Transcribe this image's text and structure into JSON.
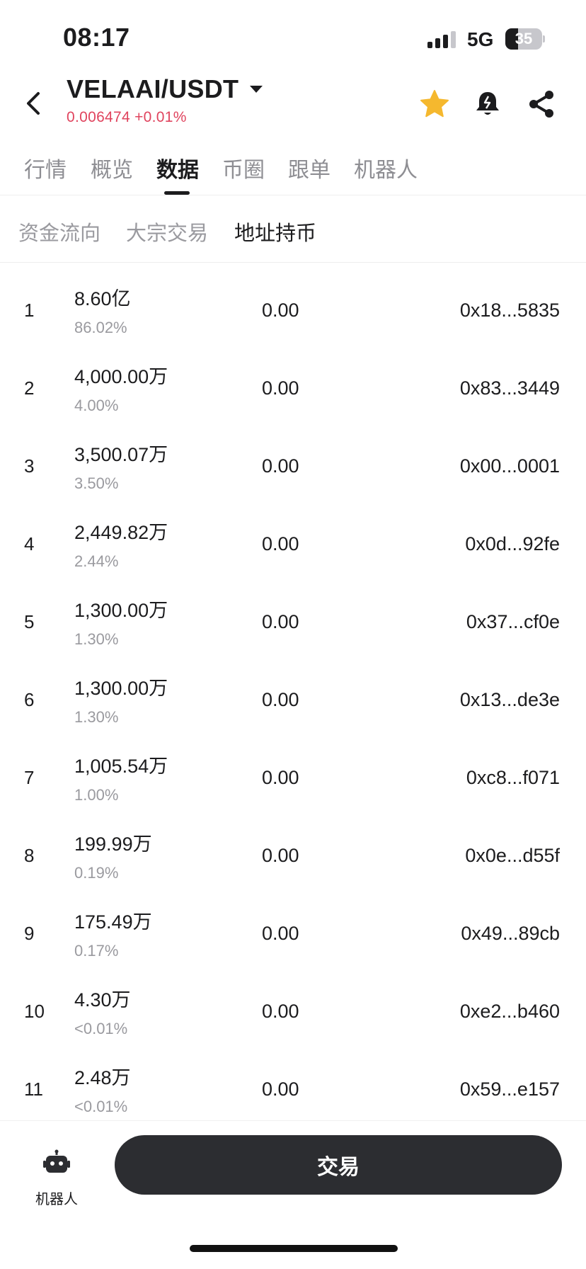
{
  "status_bar": {
    "time": "08:17",
    "network": "5G",
    "battery": "35",
    "battery_level": 0.35
  },
  "header": {
    "pair": "VELAAI/USDT",
    "price_change": "0.006474 +0.01%",
    "price_color": "#e0445e",
    "icons": [
      "back-arrow-icon",
      "dropdown-caret-icon",
      "star-icon",
      "bell-icon",
      "share-icon"
    ],
    "star_color": "#f5b82e"
  },
  "main_tabs": [
    {
      "label": "行情"
    },
    {
      "label": "概览"
    },
    {
      "label": "数据"
    },
    {
      "label": "币圈"
    },
    {
      "label": "跟单"
    },
    {
      "label": "机器人"
    }
  ],
  "active_main_tab": "数据",
  "sub_tabs": [
    {
      "label": "资金流向"
    },
    {
      "label": "大宗交易"
    },
    {
      "label": "地址持币"
    }
  ],
  "active_sub_tab": "地址持币",
  "holders": [
    {
      "rank": "1",
      "amount": "8.60亿",
      "percent": "86.02%",
      "change": "0.00",
      "address": "0x18...5835"
    },
    {
      "rank": "2",
      "amount": "4,000.00万",
      "percent": "4.00%",
      "change": "0.00",
      "address": "0x83...3449"
    },
    {
      "rank": "3",
      "amount": "3,500.07万",
      "percent": "3.50%",
      "change": "0.00",
      "address": "0x00...0001"
    },
    {
      "rank": "4",
      "amount": "2,449.82万",
      "percent": "2.44%",
      "change": "0.00",
      "address": "0x0d...92fe"
    },
    {
      "rank": "5",
      "amount": "1,300.00万",
      "percent": "1.30%",
      "change": "0.00",
      "address": "0x37...cf0e"
    },
    {
      "rank": "6",
      "amount": "1,300.00万",
      "percent": "1.30%",
      "change": "0.00",
      "address": "0x13...de3e"
    },
    {
      "rank": "7",
      "amount": "1,005.54万",
      "percent": "1.00%",
      "change": "0.00",
      "address": "0xc8...f071"
    },
    {
      "rank": "8",
      "amount": "199.99万",
      "percent": "0.19%",
      "change": "0.00",
      "address": "0x0e...d55f"
    },
    {
      "rank": "9",
      "amount": "175.49万",
      "percent": "0.17%",
      "change": "0.00",
      "address": "0x49...89cb"
    },
    {
      "rank": "10",
      "amount": "4.30万",
      "percent": "<0.01%",
      "change": "0.00",
      "address": "0xe2...b460"
    },
    {
      "rank": "11",
      "amount": "2.48万",
      "percent": "<0.01%",
      "change": "0.00",
      "address": "0x59...e157"
    }
  ],
  "bottom_bar": {
    "robot_label": "机器人",
    "robot_icon": "robot-icon",
    "trade_label": "交易",
    "trade_color": "#2c2d31"
  }
}
